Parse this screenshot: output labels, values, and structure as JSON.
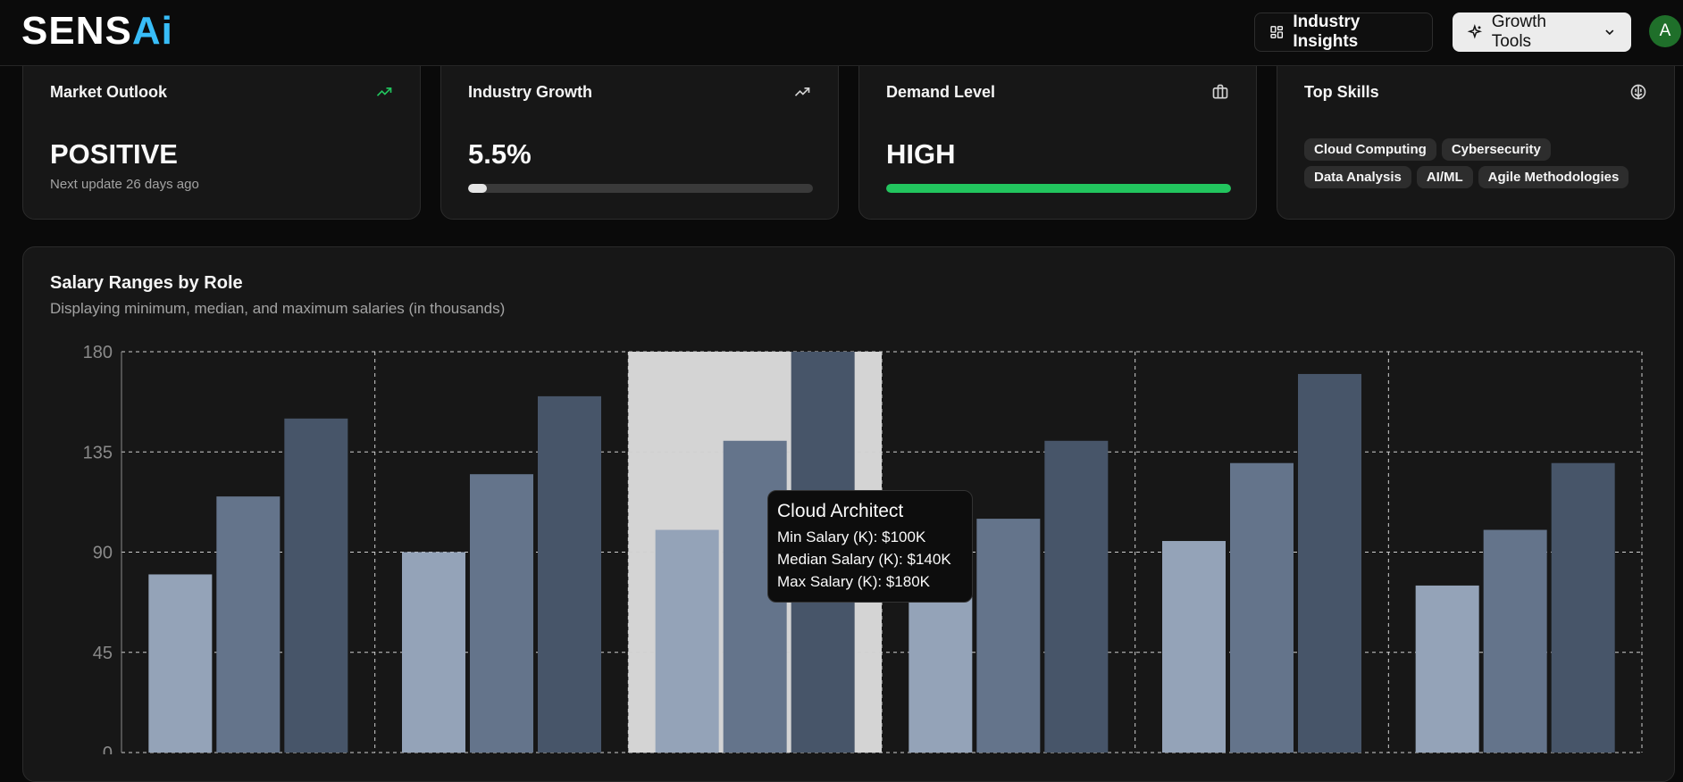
{
  "header": {
    "logo_main": "SENS",
    "logo_ai": "Ai",
    "insights_label": "Industry Insights",
    "growth_label": "Growth Tools",
    "avatar_initial": "A"
  },
  "cards": {
    "market": {
      "title": "Market Outlook",
      "value": "POSITIVE",
      "sub": "Next update 26 days ago",
      "icon": "trending-up-icon",
      "icon_color": "#22c55e"
    },
    "growth": {
      "title": "Industry Growth",
      "value": "5.5%",
      "progress_percent": 5.5,
      "icon": "trending-up-icon"
    },
    "demand": {
      "title": "Demand Level",
      "value": "HIGH",
      "progress_percent": 100,
      "bar_color": "#22c55e",
      "icon": "briefcase-icon"
    },
    "skills": {
      "title": "Top Skills",
      "icon": "brain-icon",
      "items": [
        "Cloud Computing",
        "Cybersecurity",
        "Data Analysis",
        "AI/ML",
        "Agile Methodologies"
      ]
    }
  },
  "salary": {
    "title": "Salary Ranges by Role",
    "subtitle": "Displaying minimum, median, and maximum salaries (in thousands)",
    "tooltip": {
      "title": "Cloud Architect",
      "min": "Min Salary (K): $100K",
      "median": "Median Salary (K): $140K",
      "max": "Max Salary (K): $180K"
    }
  },
  "chart_data": {
    "type": "bar",
    "categories": [
      "",
      "",
      "Cloud Architect",
      "",
      "",
      ""
    ],
    "series": [
      {
        "name": "Min Salary (K)",
        "values": [
          80,
          90,
          100,
          85,
          95,
          75
        ],
        "color": "#94a3b8"
      },
      {
        "name": "Median Salary (K)",
        "values": [
          115,
          125,
          140,
          105,
          130,
          100
        ],
        "color": "#64748b"
      },
      {
        "name": "Max Salary (K)",
        "values": [
          150,
          160,
          180,
          140,
          170,
          130
        ],
        "color": "#475569"
      }
    ],
    "yticks": [
      0,
      45,
      90,
      135,
      180
    ],
    "ylim": [
      0,
      180
    ],
    "grid": true,
    "highlighted_category_index": 2
  }
}
